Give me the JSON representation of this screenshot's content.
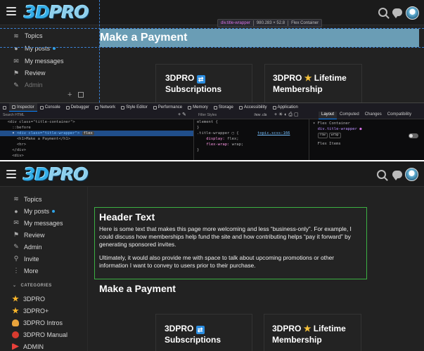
{
  "site": {
    "logo_text": "3D",
    "logo_text_2": "PRO"
  },
  "top": {
    "sidebar": [
      {
        "label": "Topics",
        "icon": "layers-icon",
        "glyph": "≋"
      },
      {
        "label": "My posts",
        "icon": "user-icon",
        "glyph": "●",
        "unread": true
      },
      {
        "label": "My messages",
        "icon": "inbox-icon",
        "glyph": "✉"
      },
      {
        "label": "Review",
        "icon": "flag-icon",
        "glyph": "⚑"
      },
      {
        "label": "Admin",
        "icon": "wrench-icon",
        "glyph": "✎"
      }
    ],
    "banner_title": "Make a Payment",
    "tooltip": {
      "name": "div.title-wrapper",
      "size": "980.283 × 52.8",
      "type": "Flex Container"
    },
    "cards": [
      {
        "line1": "3DPRO",
        "icon": "sync-icon",
        "line2": "Subscriptions"
      },
      {
        "line1": "3DPRO",
        "icon": "star-icon",
        "line1b": "Lifetime",
        "line2": "Membership"
      }
    ]
  },
  "devtools": {
    "tabs": [
      "Inspector",
      "Console",
      "Debugger",
      "Network",
      "Style Editor",
      "Performance",
      "Memory",
      "Storage",
      "Accessibility",
      "Application"
    ],
    "search_placeholder": "Search HTML",
    "filter_placeholder": "Filter Styles",
    "hov_label": ":hov  .cls",
    "right_tabs": [
      "Layout",
      "Computed",
      "Changes",
      "Compatibility"
    ],
    "html_lines": [
      "  <div class=\"title-container\">",
      "    ::before",
      "<div class=\"title-wrapper\">",
      "      <h1>Make a Payment</h1>",
      "      <hr>",
      "    </div>",
      "    <div>"
    ],
    "flex_badge": "flex",
    "rules": {
      "element": "element {",
      "close": "}",
      "selector": ".title-wrapper",
      "source": "topic.scss:166",
      "display_prop": "display:",
      "display_val": "flex;",
      "wrap_prop": "flex-wrap:",
      "wrap_val": "wrap;"
    },
    "layout": {
      "section": "Flex Container",
      "item": "div.title-wrapper",
      "pills": [
        "row",
        "wrap"
      ],
      "items_section": "Flex Items"
    }
  },
  "bottom": {
    "sidebar": [
      {
        "label": "Topics",
        "glyph": "≋"
      },
      {
        "label": "My posts",
        "glyph": "●",
        "unread": true
      },
      {
        "label": "My messages",
        "glyph": "✉"
      },
      {
        "label": "Review",
        "glyph": "⚑"
      },
      {
        "label": "Admin",
        "glyph": "✎"
      },
      {
        "label": "Invite",
        "glyph": "⚲"
      },
      {
        "label": "More",
        "glyph": "⋮"
      }
    ],
    "categories_label": "CATEGORIES",
    "categories": [
      {
        "label": "3DPRO",
        "color": "#f6b42a"
      },
      {
        "label": "3DPRO+",
        "color": "#f6b42a"
      },
      {
        "label": "3DPRO Intros",
        "color": "#e9a43c"
      },
      {
        "label": "3DPRO Manual",
        "color": "#d83b2f"
      },
      {
        "label": "ADMIN",
        "color": "#e8403a"
      }
    ],
    "header_box": {
      "title": "Header Text",
      "p1": "Here is some text that makes this page more welcoming and less “business-only”. For example, I could discuss how memberships help fund the site and how contributing helps “pay it forward” by generating sponsored invites.",
      "p2": "Ultimately, it would also provide me with space to talk about upcoming promotions or other information I want to convey to users prior to their purchase."
    },
    "page_title": "Make a Payment",
    "cards": [
      {
        "line1": "3DPRO",
        "line2": "Subscriptions"
      },
      {
        "line1": "3DPRO",
        "line1b": "Lifetime",
        "line2": "Membership"
      }
    ]
  },
  "colors": {
    "accent_blue": "#2fa4e7",
    "banner": "#6a9db5",
    "green_border": "#3cb043",
    "selection": "#204e8a"
  }
}
